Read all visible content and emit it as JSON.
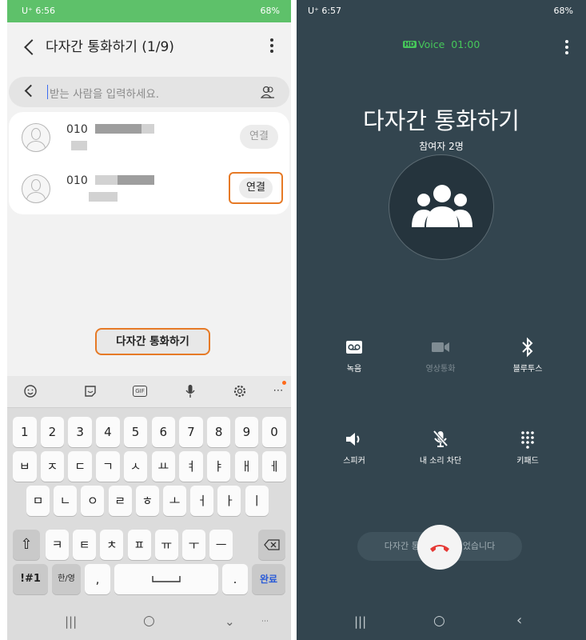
{
  "left": {
    "status": {
      "time": "U⁺ 6:56",
      "battery": "68%"
    },
    "title": "다자간 통화하기 (1/9)",
    "search": {
      "placeholder": "받는 사람을 입력하세요."
    },
    "contacts": [
      {
        "number": "010",
        "connect_label": "연결"
      },
      {
        "number": "010",
        "connect_label": "연결"
      }
    ],
    "conference_label": "다자간 통화하기",
    "keyboard": {
      "toolbar": [
        "emoji-icon",
        "sticker-icon",
        "gif-icon",
        "mic-icon",
        "settings-icon",
        "more-icon"
      ],
      "gif": "GIF",
      "rows": [
        [
          "1",
          "2",
          "3",
          "4",
          "5",
          "6",
          "7",
          "8",
          "9",
          "0"
        ],
        [
          "ㅂ",
          "ㅈ",
          "ㄷ",
          "ㄱ",
          "ㅅ",
          "ㅛ",
          "ㅕ",
          "ㅑ",
          "ㅐ",
          "ㅔ"
        ],
        [
          "ㅁ",
          "ㄴ",
          "ㅇ",
          "ㄹ",
          "ㅎ",
          "ㅗ",
          "ㅓ",
          "ㅏ",
          "ㅣ"
        ],
        [
          "ㅋ",
          "ㅌ",
          "ㅊ",
          "ㅍ",
          "ㅠ",
          "ㅜ",
          "ㅡ"
        ]
      ],
      "sym": "!#1",
      "lang": "한/영",
      "comma": ",",
      "period": ".",
      "done": "완료"
    }
  },
  "right": {
    "status": {
      "time": "U⁺ 6:57",
      "battery": "68%"
    },
    "hd_badge": "HD",
    "voice_label": "Voice",
    "call_time": "01:00",
    "call_title": "다자간 통화하기",
    "participants": "참여자 2명",
    "actions": [
      {
        "label": "녹음",
        "icon": "voicemail-icon",
        "enabled": true
      },
      {
        "label": "영상통화",
        "icon": "video-icon",
        "enabled": false
      },
      {
        "label": "블루투스",
        "icon": "bluetooth-icon",
        "enabled": true
      },
      {
        "label": "스피커",
        "icon": "speaker-icon",
        "enabled": true
      },
      {
        "label": "내 소리 차단",
        "icon": "mic-mute-icon",
        "enabled": true
      },
      {
        "label": "키패드",
        "icon": "keypad-icon",
        "enabled": true
      }
    ],
    "toast": "다자간 통화로 연결되었습니다"
  },
  "colors": {
    "status_green": "#5ec16a",
    "highlight_orange": "#e67a26",
    "call_bg": "#33454f",
    "hd_green": "#46c85a",
    "end_red": "#e53935"
  }
}
